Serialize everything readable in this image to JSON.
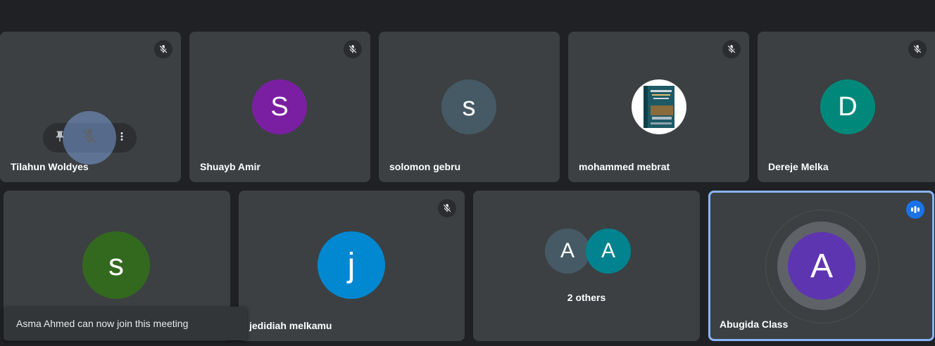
{
  "participants": [
    {
      "name": "Tilahun Woldyes",
      "muted": true
    },
    {
      "name": "Shuayb Amir",
      "initial": "S",
      "color": "#7b1fa2",
      "muted": true
    },
    {
      "name": "solomon gebru",
      "initial": "s",
      "color": "#455a64",
      "muted": false
    },
    {
      "name": "mohammed mebrat",
      "avatar": "book-cover-photo",
      "muted": true
    },
    {
      "name": "Dereje Melka",
      "initial": "D",
      "color": "#00897b",
      "muted": true
    },
    {
      "name": "",
      "initial": "s",
      "color": "#33691e",
      "muted": false
    },
    {
      "name": "jedidiah melkamu",
      "initial": "j",
      "color": "#0288d1",
      "muted": true
    },
    {
      "name": "Abugida Class",
      "initial": "A",
      "color": "#5e35b1",
      "speaking": true
    }
  ],
  "others": {
    "label": "2 others",
    "initials": [
      "A",
      "A"
    ],
    "colors": [
      "#455a64",
      "#00838f"
    ]
  },
  "hover_controls": [
    "pin-icon",
    "mute-icon",
    "more-vert-icon"
  ],
  "toast": {
    "message": "Asma Ahmed can now join this meeting"
  },
  "colors": {
    "background": "#202124",
    "tile": "#3c4043",
    "active_border": "#8ab4f8",
    "speaking_badge": "#1a73e8"
  }
}
